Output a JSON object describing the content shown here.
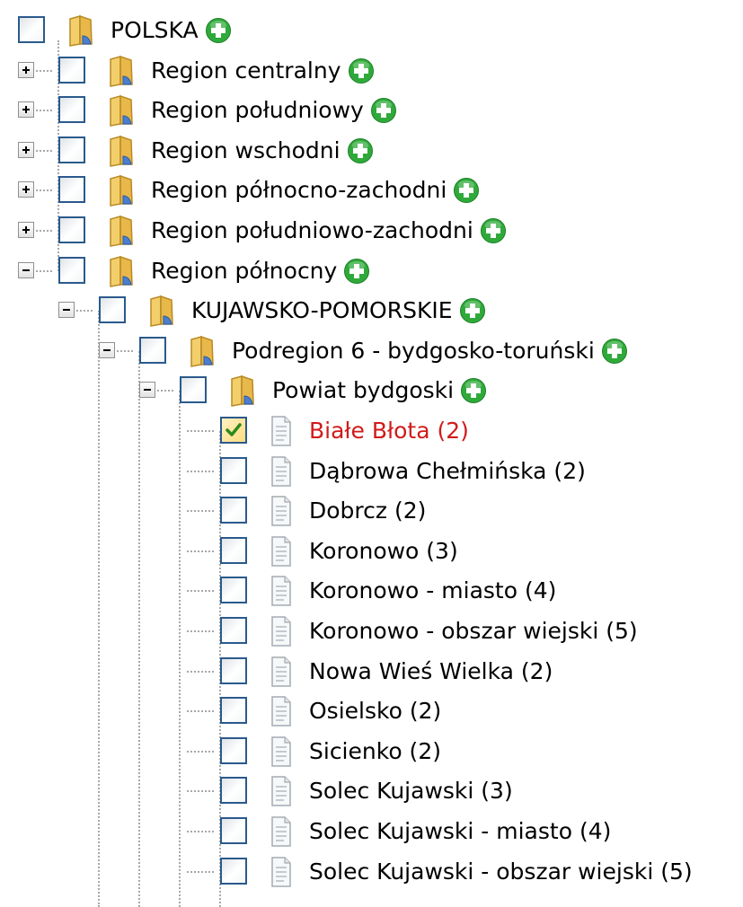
{
  "tree": {
    "root": {
      "label": "POLSKA",
      "expanded": true,
      "checked": false,
      "icon": "folder-icon",
      "action_icon": "add-icon"
    },
    "regions": [
      {
        "label": "Region centralny",
        "expanded": false,
        "checked": false,
        "icon": "folder-icon",
        "action_icon": "add-icon"
      },
      {
        "label": "Region południowy",
        "expanded": false,
        "checked": false,
        "icon": "folder-icon",
        "action_icon": "add-icon"
      },
      {
        "label": "Region wschodni",
        "expanded": false,
        "checked": false,
        "icon": "folder-icon",
        "action_icon": "add-icon"
      },
      {
        "label": "Region północno-zachodni",
        "expanded": false,
        "checked": false,
        "icon": "folder-icon",
        "action_icon": "add-icon"
      },
      {
        "label": "Region południowo-zachodni",
        "expanded": false,
        "checked": false,
        "icon": "folder-icon",
        "action_icon": "add-icon"
      },
      {
        "label": "Region północny",
        "expanded": true,
        "checked": false,
        "icon": "folder-icon",
        "action_icon": "add-icon"
      }
    ],
    "voivodeship": {
      "label": "KUJAWSKO-POMORSKIE",
      "expanded": true,
      "checked": false,
      "icon": "folder-icon",
      "action_icon": "add-icon"
    },
    "subregion": {
      "label": "Podregion 6 - bydgosko-toruński",
      "expanded": true,
      "checked": false,
      "icon": "folder-icon",
      "action_icon": "add-icon"
    },
    "county": {
      "label": "Powiat bydgoski",
      "expanded": true,
      "checked": false,
      "icon": "folder-icon",
      "action_icon": "add-icon"
    },
    "communes": [
      {
        "label": "Białe Błota (2)",
        "checked": true,
        "highlighted": true,
        "icon": "document-icon"
      },
      {
        "label": "Dąbrowa Chełmińska (2)",
        "checked": false,
        "highlighted": false,
        "icon": "document-icon"
      },
      {
        "label": "Dobrcz (2)",
        "checked": false,
        "highlighted": false,
        "icon": "document-icon"
      },
      {
        "label": "Koronowo (3)",
        "checked": false,
        "highlighted": false,
        "icon": "document-icon"
      },
      {
        "label": "Koronowo - miasto (4)",
        "checked": false,
        "highlighted": false,
        "icon": "document-icon"
      },
      {
        "label": "Koronowo - obszar wiejski (5)",
        "checked": false,
        "highlighted": false,
        "icon": "document-icon"
      },
      {
        "label": "Nowa Wieś Wielka (2)",
        "checked": false,
        "highlighted": false,
        "icon": "document-icon"
      },
      {
        "label": "Osielsko (2)",
        "checked": false,
        "highlighted": false,
        "icon": "document-icon"
      },
      {
        "label": "Sicienko (2)",
        "checked": false,
        "highlighted": false,
        "icon": "document-icon"
      },
      {
        "label": "Solec Kujawski (3)",
        "checked": false,
        "highlighted": false,
        "icon": "document-icon"
      },
      {
        "label": "Solec Kujawski - miasto (4)",
        "checked": false,
        "highlighted": false,
        "icon": "document-icon"
      },
      {
        "label": "Solec Kujawski - obszar wiejski (5)",
        "checked": false,
        "highlighted": false,
        "icon": "document-icon"
      }
    ]
  },
  "colors": {
    "highlight_text": "#d11a1a",
    "checkbox_border": "#2a5a8c",
    "add_icon": "#2faa3a",
    "folder": "#e9b84a"
  }
}
